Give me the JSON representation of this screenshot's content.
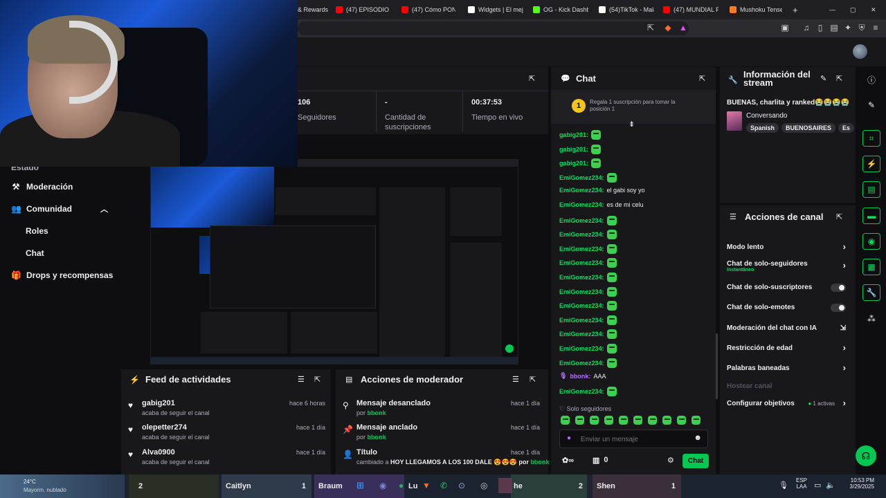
{
  "browser": {
    "tabs": [
      {
        "label": "& Rewards",
        "color": "#ff4d4d"
      },
      {
        "label": "(47) EPISODIO CC",
        "color": "#ff0000"
      },
      {
        "label": "(47) Cómo PONE",
        "color": "#ff0000"
      },
      {
        "label": "Widgets | El mejo",
        "color": "#ffffff"
      },
      {
        "label": "OG - Kick Dashbo",
        "color": "#53fc18"
      },
      {
        "label": "(54)TikTok - Mala",
        "color": "#ffffff"
      },
      {
        "label": "(47) MUNDIAL PI",
        "color": "#ff0000"
      },
      {
        "label": "Mushoku Tensei",
        "color": "#ff7a1a"
      }
    ],
    "new_tab": "+",
    "window_controls": [
      "—",
      "▢",
      "✕"
    ]
  },
  "sidebar": {
    "cut_label": "Estado",
    "items": [
      {
        "label": "Moderación",
        "icon": "wrench-icon",
        "glyph": "⚒"
      },
      {
        "label": "Comunidad",
        "icon": "people-icon",
        "glyph": "👥"
      },
      {
        "label": "Drops y recompensas",
        "icon": "gift-icon",
        "glyph": "🎁"
      }
    ],
    "sub_items": [
      "Roles",
      "Chat"
    ]
  },
  "stats": {
    "followers_value": "106",
    "followers_label": "Seguidores",
    "subs_value": "-",
    "subs_label": "Cantidad de suscripciones",
    "time_value": "00:37:53",
    "time_label": "Tiempo en vivo"
  },
  "feed": {
    "title": "Feed de actividades",
    "items": [
      {
        "name": "gabig201",
        "sub": "acaba de seguir el canal",
        "time": "hace 6 horas"
      },
      {
        "name": "olepetter274",
        "sub": "acaba de seguir el canal",
        "time": "hace 1 día"
      },
      {
        "name": "Alva0900",
        "sub": "acaba de seguir el canal",
        "time": "hace 1 día"
      }
    ]
  },
  "mod_actions": {
    "title": "Acciones de moderador",
    "items": [
      {
        "title": "Mensaje desanclado",
        "by_prefix": "por",
        "by": "bbonk",
        "time": "hace 1 día"
      },
      {
        "title": "Mensaje anclado",
        "by_prefix": "por",
        "by": "bbonk",
        "time": "hace 1 día"
      },
      {
        "title": "Título",
        "by_prefix": "cambiado a",
        "detail": "HOY LLEGAMOS A LOS 100 DALE 😍😍😍 por",
        "by": "bbonk",
        "time": "hace 1 día"
      }
    ]
  },
  "chat": {
    "title": "Chat",
    "pinned_rank": "1",
    "pinned_text": "Regala 1 suscripción para tomar la posición 1",
    "messages": [
      {
        "user": "gabig201:",
        "text": "",
        "emote": true
      },
      {
        "user": "gabig201:",
        "text": "",
        "emote": true
      },
      {
        "user": "gabig201:",
        "text": "",
        "emote": true
      },
      {
        "user": "EmiGomez234:",
        "text": "",
        "emote": true
      },
      {
        "user": "EmiGomez234:",
        "text": "el gabi soy yo",
        "emote": false
      },
      {
        "user": "EmiGomez234:",
        "text": "es de mi celu",
        "emote": false
      },
      {
        "user": "EmiGomez234:",
        "text": "",
        "emote": true
      },
      {
        "user": "EmiGomez234:",
        "text": "",
        "emote": true
      },
      {
        "user": "EmiGomez234:",
        "text": "",
        "emote": true
      },
      {
        "user": "EmiGomez234:",
        "text": "",
        "emote": true
      },
      {
        "user": "EmiGomez234:",
        "text": "",
        "emote": true
      },
      {
        "user": "EmiGomez234:",
        "text": "",
        "emote": true
      },
      {
        "user": "EmiGomez234:",
        "text": "",
        "emote": true
      },
      {
        "user": "EmiGomez234:",
        "text": "",
        "emote": true
      },
      {
        "user": "EmiGomez234:",
        "text": "",
        "emote": true
      },
      {
        "user": "EmiGomez234:",
        "text": "",
        "emote": true
      },
      {
        "user": "EmiGomez234:",
        "text": "",
        "emote": true
      },
      {
        "user": "bbonk:",
        "text": "AAA",
        "emote": false,
        "color": "#b76cff"
      },
      {
        "user": "EmiGomez234:",
        "text": "",
        "emote": true
      }
    ],
    "followers_only": "Solo seguidores",
    "input_placeholder": "Enviar un mensaje",
    "viewer_count": "0",
    "send_label": "Chat"
  },
  "stream_info": {
    "title": "Información del stream",
    "stream_title": "BUENAS, charlita y ranked😭😭😭😭",
    "category": "Conversando",
    "tags": [
      "Spanish",
      "BUENOSAIRES",
      "Es"
    ]
  },
  "channel_actions": {
    "title": "Acciones de canal",
    "items": [
      {
        "label": "Modo lento",
        "control": "chevron"
      },
      {
        "label": "Chat de solo-seguidores",
        "sub": "Instantáneo",
        "control": "chevron"
      },
      {
        "label": "Chat de solo-suscriptores",
        "control": "toggle"
      },
      {
        "label": "Chat de solo-emotes",
        "control": "toggle"
      },
      {
        "label": "Moderación del chat con IA",
        "control": "external"
      },
      {
        "label": "Restricción de edad",
        "control": "chevron"
      },
      {
        "label": "Palabras baneadas",
        "control": "chevron"
      },
      {
        "label": "Hostear canal",
        "control": "none",
        "disabled": true
      },
      {
        "label": "Configurar objetivos",
        "control": "chevron",
        "badge": "1 activas"
      }
    ]
  },
  "taskbar": {
    "weather_temp": "24°C",
    "weather_desc": "Mayorm. nublado",
    "slots": [
      {
        "name": "",
        "count": "2"
      },
      {
        "name": "Caitlyn",
        "count": "1"
      },
      {
        "name": "Braum",
        "count": ""
      },
      {
        "name": "Lu",
        "count": ""
      },
      {
        "name": "he",
        "count": "2"
      },
      {
        "name": "Shen",
        "count": "1"
      }
    ],
    "lang": "ESP",
    "lang2": "LAA",
    "time": "10:53 PM",
    "date": "3/29/2025"
  }
}
